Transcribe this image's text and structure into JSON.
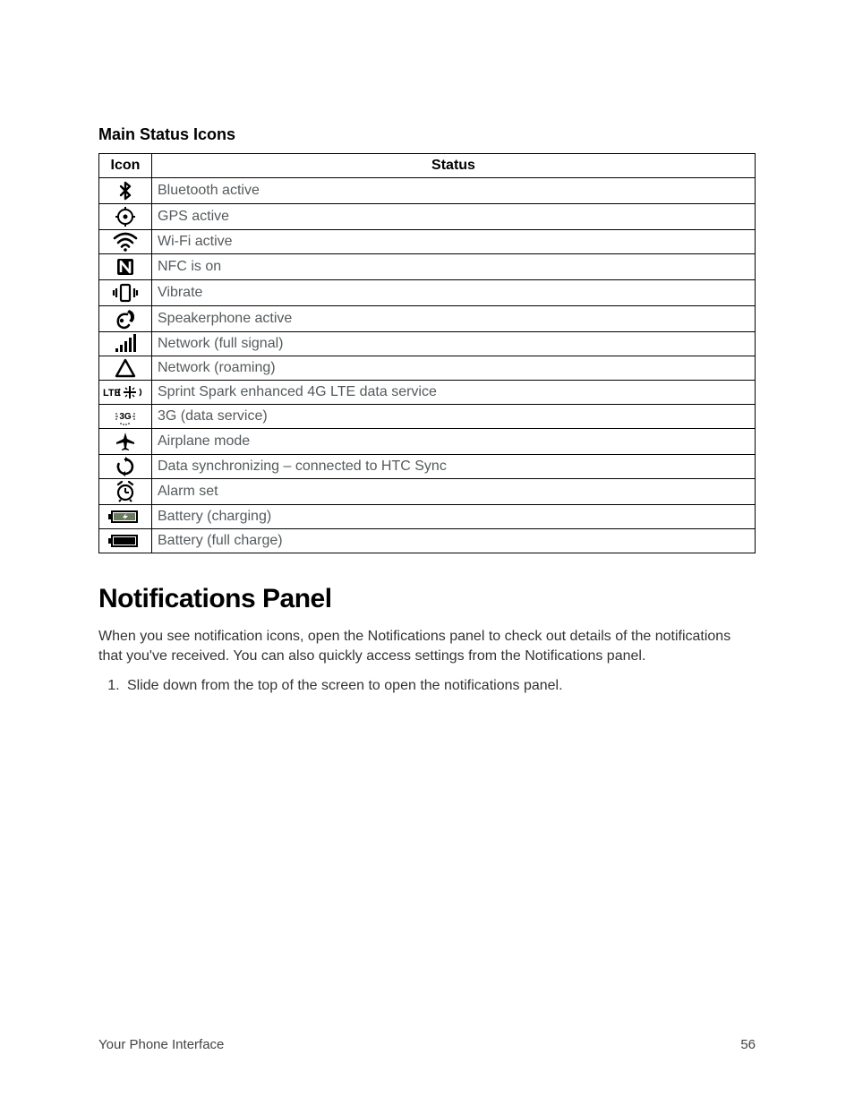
{
  "sectionHeading": "Main Status Icons",
  "table": {
    "headers": {
      "icon": "Icon",
      "status": "Status"
    },
    "rows": [
      {
        "iconName": "bluetooth-icon",
        "status": "Bluetooth active"
      },
      {
        "iconName": "gps-icon",
        "status": "GPS active"
      },
      {
        "iconName": "wifi-icon",
        "status": "Wi-Fi active"
      },
      {
        "iconName": "nfc-icon",
        "status": "NFC is on"
      },
      {
        "iconName": "vibrate-icon",
        "status": "Vibrate"
      },
      {
        "iconName": "speakerphone-icon",
        "status": "Speakerphone active"
      },
      {
        "iconName": "signal-full-icon",
        "status": "Network (full signal)"
      },
      {
        "iconName": "roaming-icon",
        "status": "Network (roaming)"
      },
      {
        "iconName": "lte-spark-icon",
        "status": "Sprint Spark enhanced 4G LTE data service"
      },
      {
        "iconName": "3g-icon",
        "status": "3G (data service)"
      },
      {
        "iconName": "airplane-icon",
        "status": "Airplane mode"
      },
      {
        "iconName": "sync-icon",
        "status": "Data synchronizing – connected to HTC Sync"
      },
      {
        "iconName": "alarm-icon",
        "status": "Alarm set"
      },
      {
        "iconName": "battery-charging-icon",
        "status": "Battery (charging)"
      },
      {
        "iconName": "battery-full-icon",
        "status": "Battery (full charge)"
      }
    ]
  },
  "notifications": {
    "heading": "Notifications Panel",
    "paragraph": "When you see notification icons, open the Notifications panel to check out details of the notifications that you've received. You can also quickly access settings from the Notifications panel.",
    "step1": "Slide down from the top of the screen to open the notifications panel."
  },
  "footer": {
    "left": "Your Phone Interface",
    "right": "56"
  }
}
